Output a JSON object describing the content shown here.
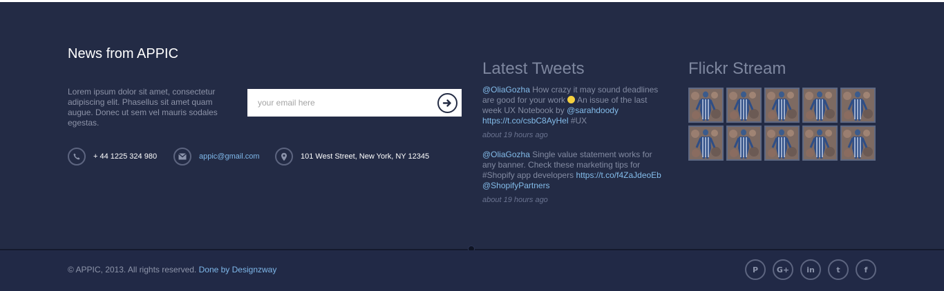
{
  "newsletter": {
    "title": "News from APPIC",
    "text": "Lorem ipsum dolor sit amet, consectetur adipiscing elit. Phasellus sit amet quam augue. Donec ut sem vel mauris sodales egestas.",
    "email_placeholder": "your email here"
  },
  "contact": {
    "phone": "+ 44 1225 324 980",
    "email": "appic@gmail.com",
    "address": "101 West Street, New York, NY 12345"
  },
  "tweets": {
    "title": "Latest Tweets",
    "items": [
      {
        "user": "@OliaGozha",
        "text_before": " How crazy it may sound deadlines are good for your work ",
        "text_after": " An issue of the last week UX Notebook by ",
        "mention": "@sarahdoody",
        "link": "https://t.co/csbC8AyHel",
        "hashtag": " #UX",
        "time": "about 19 hours ago"
      },
      {
        "user": "@OliaGozha",
        "text": " Single value statement works for any banner. Check these marketing tips for #Shopify app developers ",
        "link": "https://t.co/f4ZaJdeoEb",
        "mention": "@ShopifyPartners",
        "time": "about 19 hours ago"
      }
    ]
  },
  "flickr": {
    "title": "Flickr Stream",
    "thumbnails": [
      1,
      2,
      3,
      4,
      5,
      6,
      7,
      8,
      9,
      10
    ]
  },
  "bottom": {
    "copyright": "© APPIC, 2013. All rights reserved.",
    "credit": "Done by Designzway",
    "social": [
      {
        "name": "pinterest-icon",
        "glyph": "P"
      },
      {
        "name": "google-plus-icon",
        "glyph": "G+"
      },
      {
        "name": "linkedin-icon",
        "glyph": "in"
      },
      {
        "name": "twitter-icon",
        "glyph": "t"
      },
      {
        "name": "facebook-icon",
        "glyph": "f"
      }
    ]
  },
  "colors": {
    "background": "#232b45",
    "link": "#7fb8ea",
    "muted_text": "#8d93a8"
  }
}
